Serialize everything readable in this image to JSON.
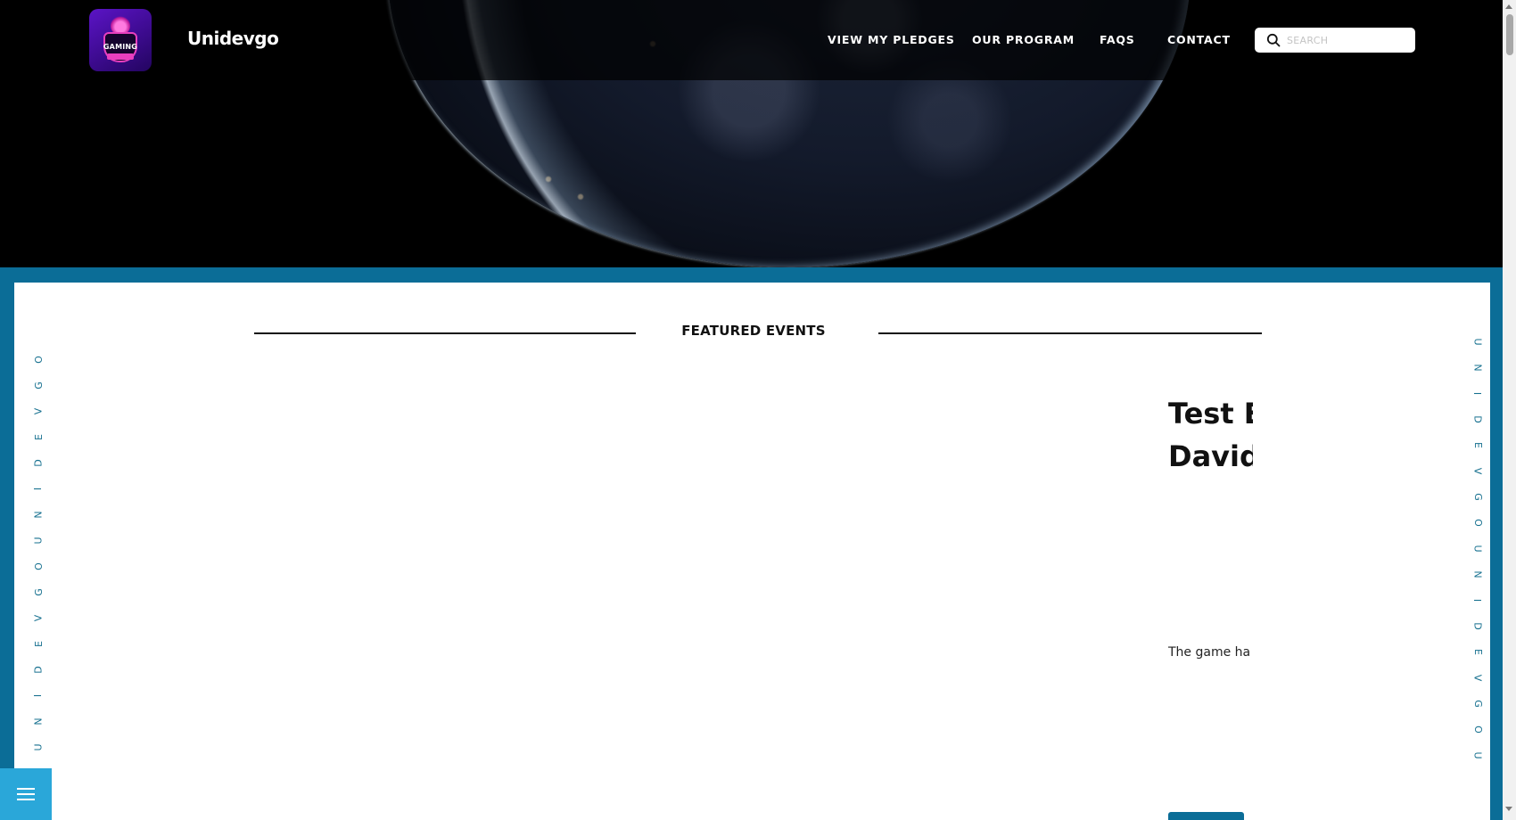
{
  "header": {
    "brand": "Unidevgo",
    "logo_text": "GAMING",
    "nav": [
      {
        "label": "VIEW MY PLEDGES"
      },
      {
        "label": "OUR PROGRAM"
      },
      {
        "label": "FAQS"
      },
      {
        "label": "CONTACT"
      }
    ],
    "search": {
      "placeholder": "SEARCH",
      "value": "",
      "icon": "search-icon"
    }
  },
  "section": {
    "title": "FEATURED EVENTS",
    "vertical_text_left": [
      "O",
      "G",
      "V",
      "E",
      "D",
      "I",
      "N",
      "U",
      "O",
      "G",
      "V",
      "E",
      "D",
      "I",
      "N",
      "U"
    ],
    "vertical_text_right": [
      "U",
      "N",
      "I",
      "D",
      "E",
      "V",
      "G",
      "O",
      "U",
      "N",
      "I",
      "D",
      "E",
      "V",
      "G",
      "O",
      "U"
    ]
  },
  "event": {
    "title_line1": "Test E",
    "title_line2": "David",
    "description": "The game ha"
  },
  "fab": {
    "icon": "menu-icon"
  },
  "colors": {
    "band": "#0b6d97",
    "fab": "#2aa7d9",
    "vertical_text": "#16708f",
    "logo_bg": "#4b10b0"
  }
}
